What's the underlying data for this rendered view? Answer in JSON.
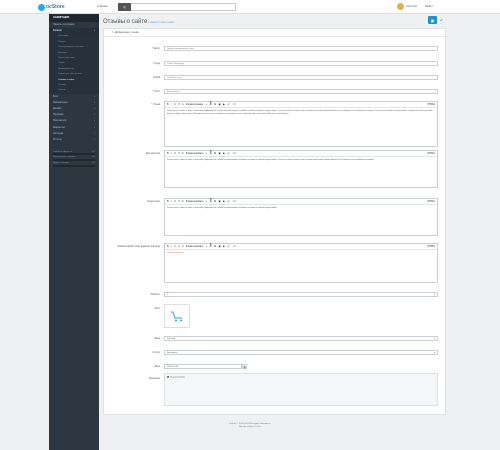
{
  "topbar": {
    "logo_text": "ocStore",
    "menu_label": "≡ Меню",
    "search_button": "Q",
    "user_name": "John Doe",
    "logout_label": "Выйти"
  },
  "sidebar": {
    "heading": "НАВИГАЦИЯ",
    "items": [
      {
        "label": "Панель состояния",
        "arrow": ""
      },
      {
        "label": "Каталог",
        "arrow": "›"
      },
      {
        "label": "Категории",
        "sub": true
      },
      {
        "label": "Товары",
        "sub": true
      },
      {
        "label": "Повторяющиеся платежи",
        "sub": true
      },
      {
        "label": "Фильтры",
        "sub": true
      },
      {
        "label": "Характеристики",
        "sub": true
      },
      {
        "label": "Опции",
        "sub": true
      },
      {
        "label": "Производители",
        "sub": true
      },
      {
        "label": "Файлы для скачивания",
        "sub": true
      },
      {
        "label": "Отзывы о сайте",
        "sub": true,
        "active": true
      },
      {
        "label": "Отзывы",
        "sub": true
      },
      {
        "label": "Статьи",
        "sub": true
      },
      {
        "label": "Блог",
        "arrow": "›"
      },
      {
        "label": "Расширения",
        "arrow": "›"
      },
      {
        "label": "Дизайн",
        "arrow": "›"
      },
      {
        "label": "Продажи",
        "arrow": "›"
      },
      {
        "label": "Покупатели",
        "arrow": "›"
      },
      {
        "label": "Маркетинг",
        "arrow": "›"
      },
      {
        "label": "Система",
        "arrow": "›"
      },
      {
        "label": "Отчеты",
        "arrow": "›"
      }
    ],
    "progress": [
      {
        "label": "Заказы в процессе",
        "value": "0%",
        "fill": 0
      },
      {
        "label": "Выполненные заказы",
        "value": "0%",
        "fill": 0
      },
      {
        "label": "Другие статусы",
        "value": "0%",
        "fill": 0
      }
    ]
  },
  "header": {
    "title": "Отзывы о сайте",
    "breadcrumb": "Главная  Отзывы о сайте"
  },
  "panel": {
    "title": "✎ Добавление отзыва",
    "fields": {
      "name": {
        "label": "* Автор",
        "value": "Демонстрационный отзыв"
      },
      "city": {
        "label": "Город",
        "value": "Санкт-Петербург"
      },
      "email": {
        "label": "E-Mail",
        "value": "test@test.com"
      },
      "rating": {
        "label": "* Текст",
        "value": "Все хорошо"
      }
    },
    "editors": [
      {
        "label": "* Отзыв",
        "text": "Lorem ipsum - dolor sit amet, consectetur adipiscing elit, sed do eiusmod tempor incididunt ut labore et dolore magna aliqua. Ut enim ad minim veniam, quis nostrud exercitation ullamco laboris nisi ut aliquip ex ea commodo consequat. Duis aute irure dolor in reprehenderit in voluptate velit esse cillum dolore eu fugiat nulla pariatur. Excepteur sint occaecat cupidatat non proident, sunt in culpa qui officia deserunt mollit anim id est laborum.",
        "red": false
      },
      {
        "label": "Достоинства",
        "text": "Lorem ipsum - dolor sit amet, consectetur adipiscing elit, sed do eiusmod tempor incididunt ut labore et dolore magna aliqua. Ut enim ad minim veniam, quis nostrud exercitation ullamco laboris nisi ut aliquip ex ea commodo consequat.",
        "red": false
      },
      {
        "label": "Недостатки",
        "text": "Lorem ipsum - dolor sit amet, consectetur adipiscing elit, sed do eiusmod tempor incididunt ut labore et dolore magna aliqua.",
        "red": false
      },
      {
        "label": "Комментарий (ответ администратора)",
        "text": "Спасибо за отзыв!",
        "red": true
      }
    ],
    "toolbar": {
      "bold": "B",
      "italic": "I",
      "underline": "U",
      "clear": "T̶",
      "color": "A",
      "style": "Форматировать",
      "list_ul": "≡",
      "list_ol": "≣",
      "table": "⊞",
      "image": "▣",
      "video": "▶",
      "link": "🔗",
      "code": "</>",
      "source": "[HTML]"
    },
    "rating_select": {
      "label": "* Рейтинг",
      "value": "5"
    },
    "image": {
      "label": "Фото"
    },
    "store_select": {
      "label": "Язык",
      "value": "Русский"
    },
    "status_select": {
      "label": "Статус",
      "value": "Включено"
    },
    "date": {
      "label": "Дата",
      "value": "2019-04-16"
    },
    "products": {
      "label": "Магазины",
      "option": "По умолчанию"
    }
  },
  "footer": {
    "line1_link": "ocStore",
    "line1": " © 2009-2019 Все права защищены.",
    "line2": "Версия ocStore 3.0.2.0"
  }
}
